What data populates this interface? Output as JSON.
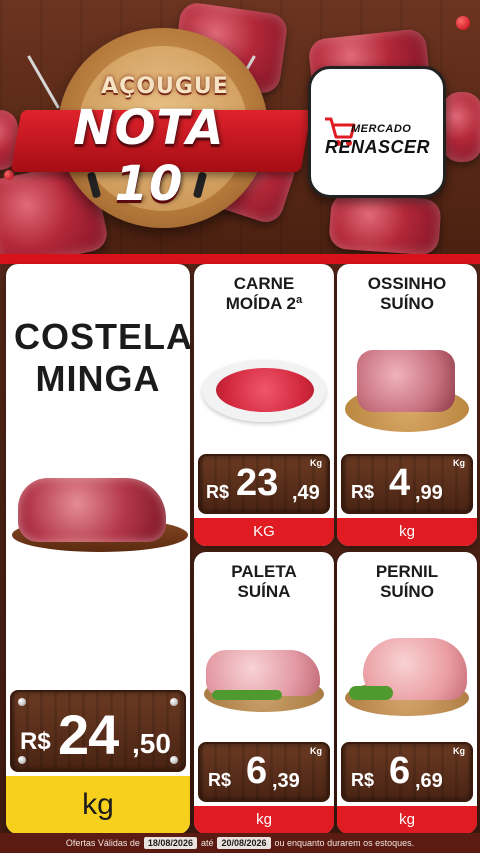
{
  "header": {
    "badge_top": "AÇOUGUE",
    "badge_main": "NOTA 10",
    "store_name_small": "MERCADO",
    "store_name_large": "RENASCER"
  },
  "products": [
    {
      "name": "COSTELA MINGA",
      "currency": "R$",
      "price_int": "24",
      "price_dec": ",50",
      "unit": "kg",
      "unit_bar_color": "#f7cf1d"
    },
    {
      "name_line1": "CARNE",
      "name_line2": "MOÍDA 2ª",
      "currency": "R$",
      "price_int": "23",
      "price_dec": ",49",
      "per": "Kg",
      "unit": "KG",
      "unit_bar_color": "#e01b21"
    },
    {
      "name_line1": "OSSINHO",
      "name_line2": "SUÍNO",
      "currency": "R$",
      "price_int": "4",
      "price_dec": ",99",
      "per": "Kg",
      "unit": "kg",
      "unit_bar_color": "#e01b21"
    },
    {
      "name_line1": "PALETA",
      "name_line2": "SUÍNA",
      "currency": "R$",
      "price_int": "6",
      "price_dec": ",39",
      "per": "Kg",
      "unit": "kg",
      "unit_bar_color": "#e01b21"
    },
    {
      "name_line1": "PERNIL",
      "name_line2": "SUÍNO",
      "currency": "R$",
      "price_int": "6",
      "price_dec": ",69",
      "per": "Kg",
      "unit": "kg",
      "unit_bar_color": "#e01b21"
    }
  ],
  "footer": {
    "text_start": "Ofertas Válidas de",
    "date_from": "18/08/2026",
    "text_mid": "até",
    "date_to": "20/08/2026",
    "text_end": "ou enquanto durarem os estoques."
  },
  "icons": [
    "shopping-cart-icon"
  ],
  "colors": {
    "brand_red": "#d8121b",
    "highlight_yellow": "#f7cf1d",
    "wood_brown": "#4a2414"
  }
}
